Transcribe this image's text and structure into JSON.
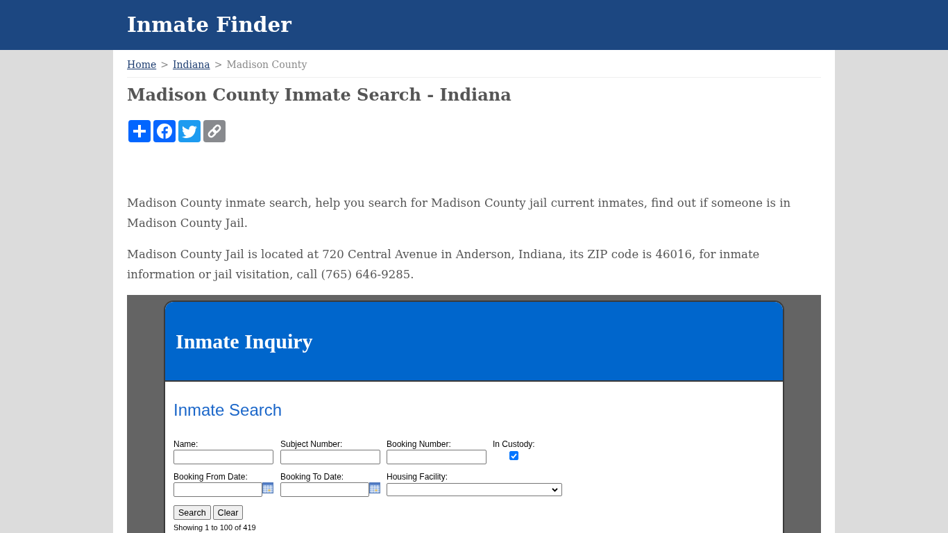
{
  "header": {
    "title": "Inmate Finder"
  },
  "breadcrumb": {
    "items": [
      {
        "label": "Home",
        "kind": "link"
      },
      {
        "label": "Indiana",
        "kind": "link"
      },
      {
        "label": "Madison County",
        "kind": "current"
      }
    ],
    "separators": [
      ">",
      ">"
    ]
  },
  "page_title": "Madison County Inmate Search - Indiana",
  "share_buttons": [
    {
      "kind": "share"
    },
    {
      "kind": "facebook"
    },
    {
      "kind": "twitter"
    },
    {
      "kind": "copy_link"
    }
  ],
  "paragraphs": [
    "Madison County inmate search, help you search for Madison County jail current inmates, find out if someone is in Madison County Jail.",
    "Madison County Jail is located at 720 Central Avenue in Anderson, Indiana, its ZIP code is 46016, for inmate information or jail visitation, call (765) 646-9285."
  ],
  "embedded_screenshot": {
    "title": "Inmate Inquiry",
    "section_title": "Inmate Search",
    "fields": [
      {
        "kind": "text",
        "label": "Name:"
      },
      {
        "kind": "text",
        "label": "Subject Number:"
      },
      {
        "kind": "text",
        "label": "Booking Number:"
      },
      {
        "kind": "checkbox",
        "label": "In Custody:",
        "checked": true
      },
      {
        "kind": "date",
        "label": "Booking From Date:"
      },
      {
        "kind": "date",
        "label": "Booking To Date:"
      },
      {
        "kind": "select",
        "label": "Housing Facility:"
      }
    ],
    "buttons": [
      "Search",
      "Clear"
    ],
    "result_count": "Showing 1 to 100 of 419"
  }
}
